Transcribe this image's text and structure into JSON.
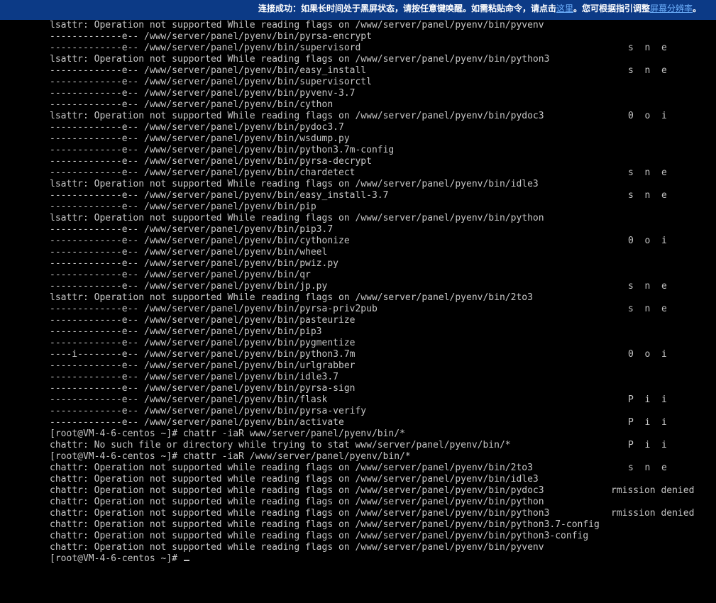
{
  "banner": {
    "text_before": "连接成功：如果长时间处于黑屏状态，请按任意键唤醒。如需粘贴命令，请点击",
    "link_paste": "这里",
    "text_middle": "。您可根据指引调整",
    "link_resolution": "屏幕分辨率",
    "text_after": "。"
  },
  "terminal": {
    "lines": [
      "lsattr: Operation not supported While reading flags on /www/server/panel/pyenv/bin/pyvenv",
      "-------------e-- /www/server/panel/pyenv/bin/pyrsa-encrypt",
      "-------------e-- /www/server/panel/pyenv/bin/supervisord",
      "lsattr: Operation not supported While reading flags on /www/server/panel/pyenv/bin/python3",
      "-------------e-- /www/server/panel/pyenv/bin/easy_install",
      "-------------e-- /www/server/panel/pyenv/bin/supervisorctl",
      "-------------e-- /www/server/panel/pyenv/bin/pyvenv-3.7",
      "-------------e-- /www/server/panel/pyenv/bin/cython",
      "lsattr: Operation not supported While reading flags on /www/server/panel/pyenv/bin/pydoc3",
      "-------------e-- /www/server/panel/pyenv/bin/pydoc3.7",
      "-------------e-- /www/server/panel/pyenv/bin/wsdump.py",
      "-------------e-- /www/server/panel/pyenv/bin/python3.7m-config",
      "-------------e-- /www/server/panel/pyenv/bin/pyrsa-decrypt",
      "-------------e-- /www/server/panel/pyenv/bin/chardetect",
      "lsattr: Operation not supported While reading flags on /www/server/panel/pyenv/bin/idle3",
      "-------------e-- /www/server/panel/pyenv/bin/easy_install-3.7",
      "-------------e-- /www/server/panel/pyenv/bin/pip",
      "lsattr: Operation not supported While reading flags on /www/server/panel/pyenv/bin/python",
      "-------------e-- /www/server/panel/pyenv/bin/pip3.7",
      "-------------e-- /www/server/panel/pyenv/bin/cythonize",
      "-------------e-- /www/server/panel/pyenv/bin/wheel",
      "-------------e-- /www/server/panel/pyenv/bin/pwiz.py",
      "-------------e-- /www/server/panel/pyenv/bin/qr",
      "-------------e-- /www/server/panel/pyenv/bin/jp.py",
      "lsattr: Operation not supported While reading flags on /www/server/panel/pyenv/bin/2to3",
      "-------------e-- /www/server/panel/pyenv/bin/pyrsa-priv2pub",
      "-------------e-- /www/server/panel/pyenv/bin/pasteurize",
      "-------------e-- /www/server/panel/pyenv/bin/pip3",
      "-------------e-- /www/server/panel/pyenv/bin/pygmentize",
      "----i--------e-- /www/server/panel/pyenv/bin/python3.7m",
      "-------------e-- /www/server/panel/pyenv/bin/urlgrabber",
      "-------------e-- /www/server/panel/pyenv/bin/idle3.7",
      "-------------e-- /www/server/panel/pyenv/bin/pyrsa-sign",
      "-------------e-- /www/server/panel/pyenv/bin/flask",
      "-------------e-- /www/server/panel/pyenv/bin/pyrsa-verify",
      "-------------e-- /www/server/panel/pyenv/bin/activate",
      "[root@VM-4-6-centos ~]# chattr -iaR www/server/panel/pyenv/bin/*",
      "chattr: No such file or directory while trying to stat www/server/panel/pyenv/bin/*",
      "[root@VM-4-6-centos ~]# chattr -iaR /www/server/panel/pyenv/bin/*",
      "chattr: Operation not supported while reading flags on /www/server/panel/pyenv/bin/2to3",
      "chattr: Operation not supported while reading flags on /www/server/panel/pyenv/bin/idle3",
      "chattr: Operation not supported while reading flags on /www/server/panel/pyenv/bin/pydoc3",
      "chattr: Operation not supported while reading flags on /www/server/panel/pyenv/bin/python",
      "chattr: Operation not supported while reading flags on /www/server/panel/pyenv/bin/python3",
      "chattr: Operation not supported while reading flags on /www/server/panel/pyenv/bin/python3.7-config",
      "chattr: Operation not supported while reading flags on /www/server/panel/pyenv/bin/python3-config",
      "chattr: Operation not supported while reading flags on /www/server/panel/pyenv/bin/pyvenv",
      "[root@VM-4-6-centos ~]# "
    ],
    "artifacts": [
      "s  n  e",
      "s  n  e",
      "0  o  i",
      "s  n  e",
      "s  n  e",
      "0  o  i",
      "s  n  e",
      "s  n  e",
      "0  o  i",
      "P  i  i",
      "P  i  i",
      "P  i  i",
      "s  n  e",
      "rmission denied",
      "rmission denied"
    ]
  }
}
